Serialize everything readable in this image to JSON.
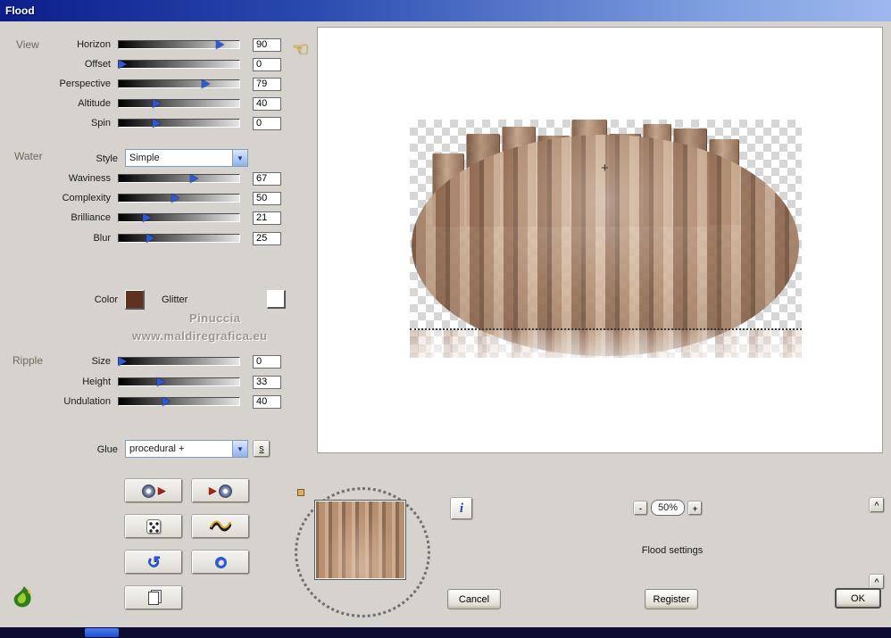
{
  "window": {
    "title": "Flood"
  },
  "view": {
    "label": "View",
    "sliders": [
      {
        "label": "Horizon",
        "value": "90",
        "pct": 84
      },
      {
        "label": "Offset",
        "value": "0",
        "pct": 3
      },
      {
        "label": "Perspective",
        "value": "79",
        "pct": 72
      },
      {
        "label": "Altitude",
        "value": "40",
        "pct": 31
      },
      {
        "label": "Spin",
        "value": "0",
        "pct": 31
      }
    ]
  },
  "water": {
    "label": "Water",
    "style_label": "Style",
    "style_value": "Simple",
    "sliders": [
      {
        "label": "Waviness",
        "value": "67",
        "pct": 62
      },
      {
        "label": "Complexity",
        "value": "50",
        "pct": 47
      },
      {
        "label": "Brilliance",
        "value": "21",
        "pct": 23
      },
      {
        "label": "Blur",
        "value": "25",
        "pct": 26
      }
    ]
  },
  "color_row": {
    "color_label": "Color",
    "glitter_label": "Glitter",
    "color_swatch": "#5f3020",
    "glitter_swatch": "#ffffff"
  },
  "watermark": {
    "line1": "Pinuccia",
    "line2": "www.maldiregrafica.eu"
  },
  "ripple": {
    "label": "Ripple",
    "sliders": [
      {
        "label": "Size",
        "value": "0",
        "pct": 3
      },
      {
        "label": "Height",
        "value": "33",
        "pct": 35
      },
      {
        "label": "Undulation",
        "value": "40",
        "pct": 39
      }
    ]
  },
  "glue": {
    "label": "Glue",
    "value": "procedural +",
    "s_button": "s"
  },
  "zoom": {
    "minus": "-",
    "value": "50%",
    "plus": "+"
  },
  "status_text": "Flood settings",
  "footer": {
    "cancel": "Cancel",
    "register": "Register",
    "ok": "OK"
  },
  "misc": {
    "info": "i",
    "up_arrow": "^",
    "hand": "☜",
    "crosshair": "+",
    "combo_arrow": "▼"
  }
}
